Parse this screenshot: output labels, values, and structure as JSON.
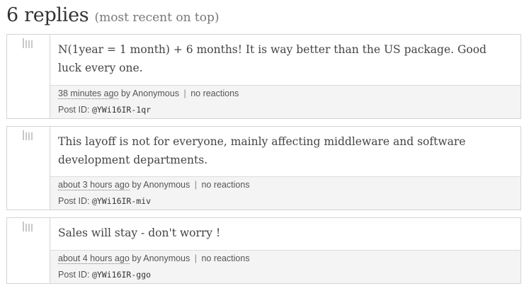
{
  "header": {
    "count_label": "6 replies",
    "order_label": "(most recent on top)"
  },
  "replies": [
    {
      "text": "N(1year = 1 month) + 6 months! It is way better than the US package. Good luck every one.",
      "time": "38 minutes ago",
      "by": "by Anonymous",
      "reactions": "no reactions",
      "post_id_label": "Post ID:",
      "post_id": "@YWi16IR-1qr"
    },
    {
      "text": "This layoff is not for everyone, mainly affecting middleware and software development departments.",
      "time": "about 3 hours ago",
      "by": "by Anonymous",
      "reactions": "no reactions",
      "post_id_label": "Post ID:",
      "post_id": "@YWi16IR-miv"
    },
    {
      "text": "Sales will stay - don't worry !",
      "time": "about 4 hours ago",
      "by": "by Anonymous",
      "reactions": "no reactions",
      "post_id_label": "Post ID:",
      "post_id": "@YWi16IR-ggo"
    }
  ],
  "icons": {
    "reply_gutter_icon": "bars-icon"
  },
  "colors": {
    "border": "#d4d4d4",
    "meta_background": "#f4f4f4",
    "icon": "#c8c8c8"
  }
}
